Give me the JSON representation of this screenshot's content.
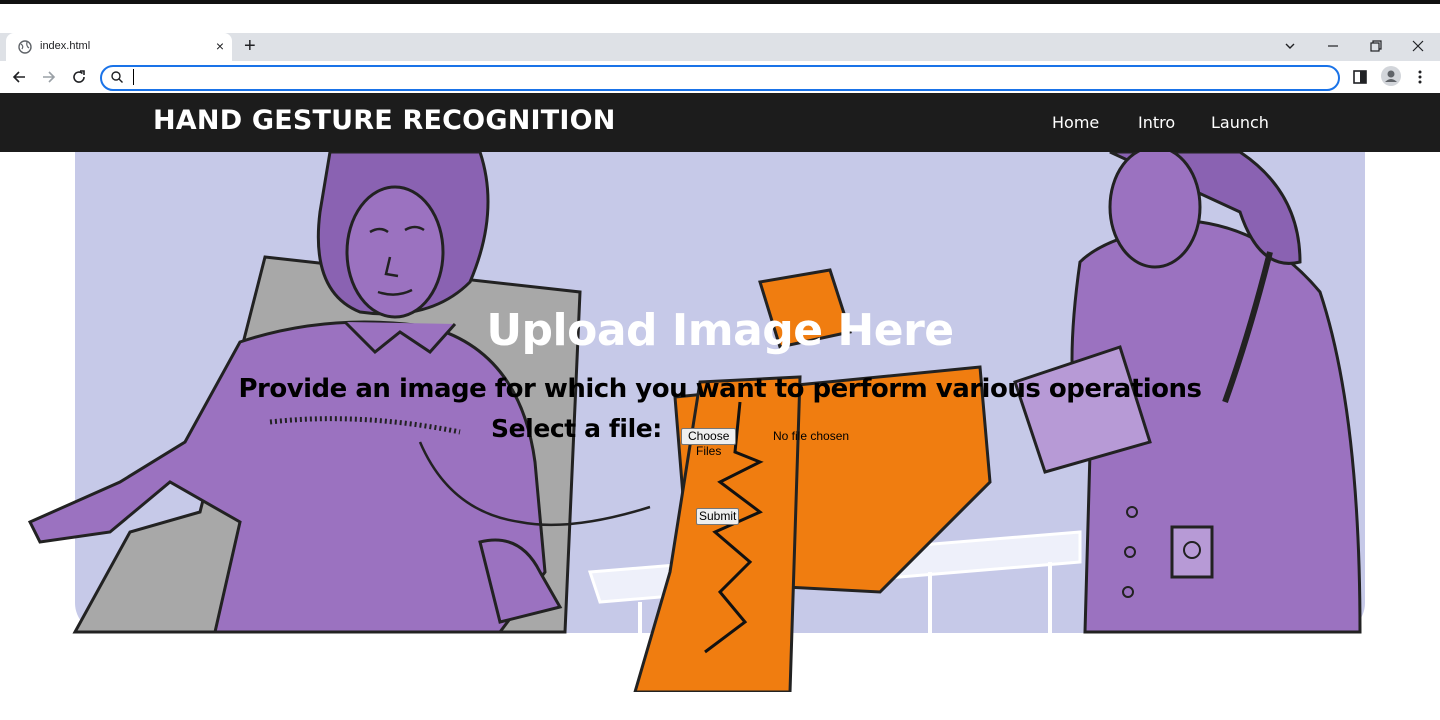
{
  "browser": {
    "tab_title": "index.html",
    "new_tab_symbol": "+",
    "close_symbol": "×",
    "address_value": "",
    "icons": [
      "globe-icon",
      "close-icon",
      "new-tab-icon",
      "tab-search-icon",
      "minimize-icon",
      "restore-icon",
      "window-close-icon",
      "back-icon",
      "forward-icon",
      "reload-icon",
      "search-icon",
      "side-panel-icon",
      "profile-icon",
      "menu-icon"
    ]
  },
  "nav": {
    "brand": "HAND GESTURE RECOGNITION",
    "links": [
      "Home",
      "Intro",
      "Launch"
    ]
  },
  "hero": {
    "title": "Upload Image Here",
    "subtitle": "Provide an image for which you want to perform various operations",
    "file_label": "Select a file:",
    "choose_button": "Choose Files",
    "no_file_text": "No file chosen",
    "submit_button": "Submit"
  },
  "colors": {
    "navbar_bg": "#1c1c1c",
    "hero_bg": "#c6c9e8",
    "purple": "#9b72c0",
    "orange": "#f07d10",
    "omnibox_focus": "#1a73e8"
  }
}
